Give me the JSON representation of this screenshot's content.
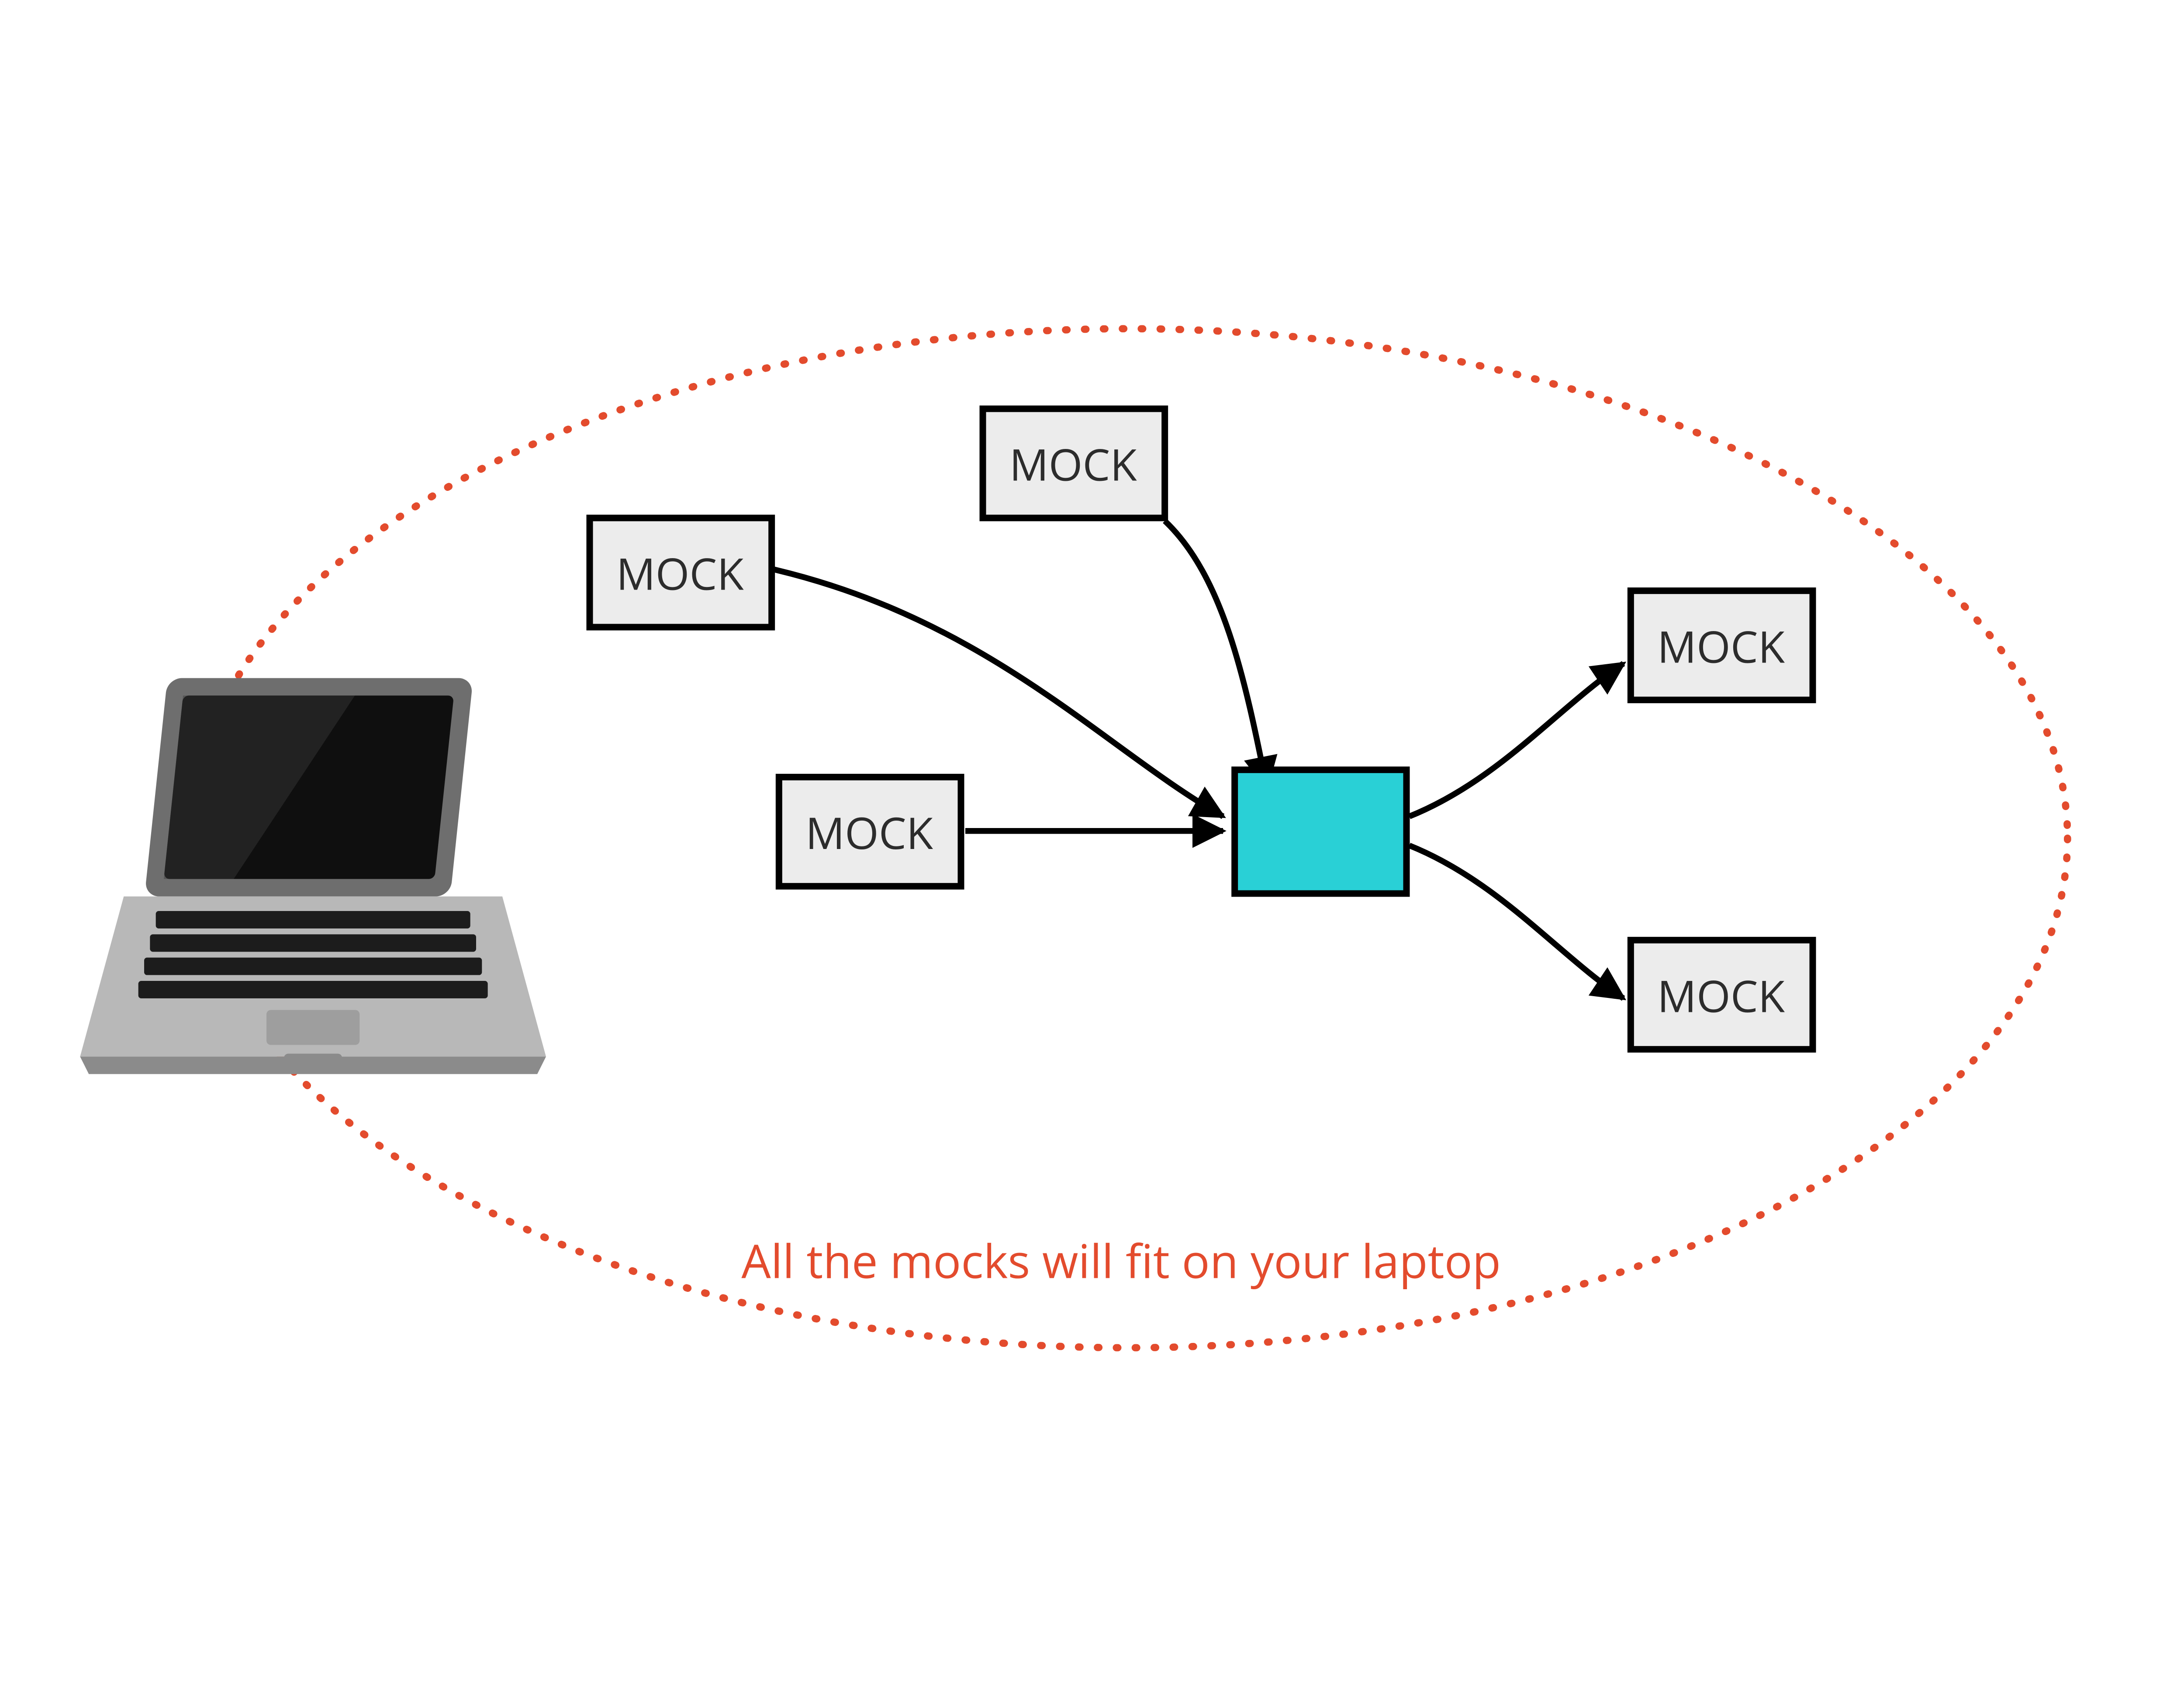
{
  "caption": "All the mocks will fit on your laptop",
  "colors": {
    "boundary": "#e34b2d",
    "target_fill": "#29d0d6",
    "mock_fill": "#ececec",
    "mock_stroke": "#000000"
  },
  "nodes": {
    "mock1": "MOCK",
    "mock2": "MOCK",
    "mock3": "MOCK",
    "mock4": "MOCK",
    "mock5": "MOCK",
    "target": ""
  },
  "edges": [
    {
      "from": "mock1",
      "to": "target",
      "dir": "in"
    },
    {
      "from": "mock2",
      "to": "target",
      "dir": "in"
    },
    {
      "from": "mock3",
      "to": "target",
      "dir": "in"
    },
    {
      "from": "target",
      "to": "mock4",
      "dir": "out"
    },
    {
      "from": "target",
      "to": "mock5",
      "dir": "out"
    }
  ]
}
